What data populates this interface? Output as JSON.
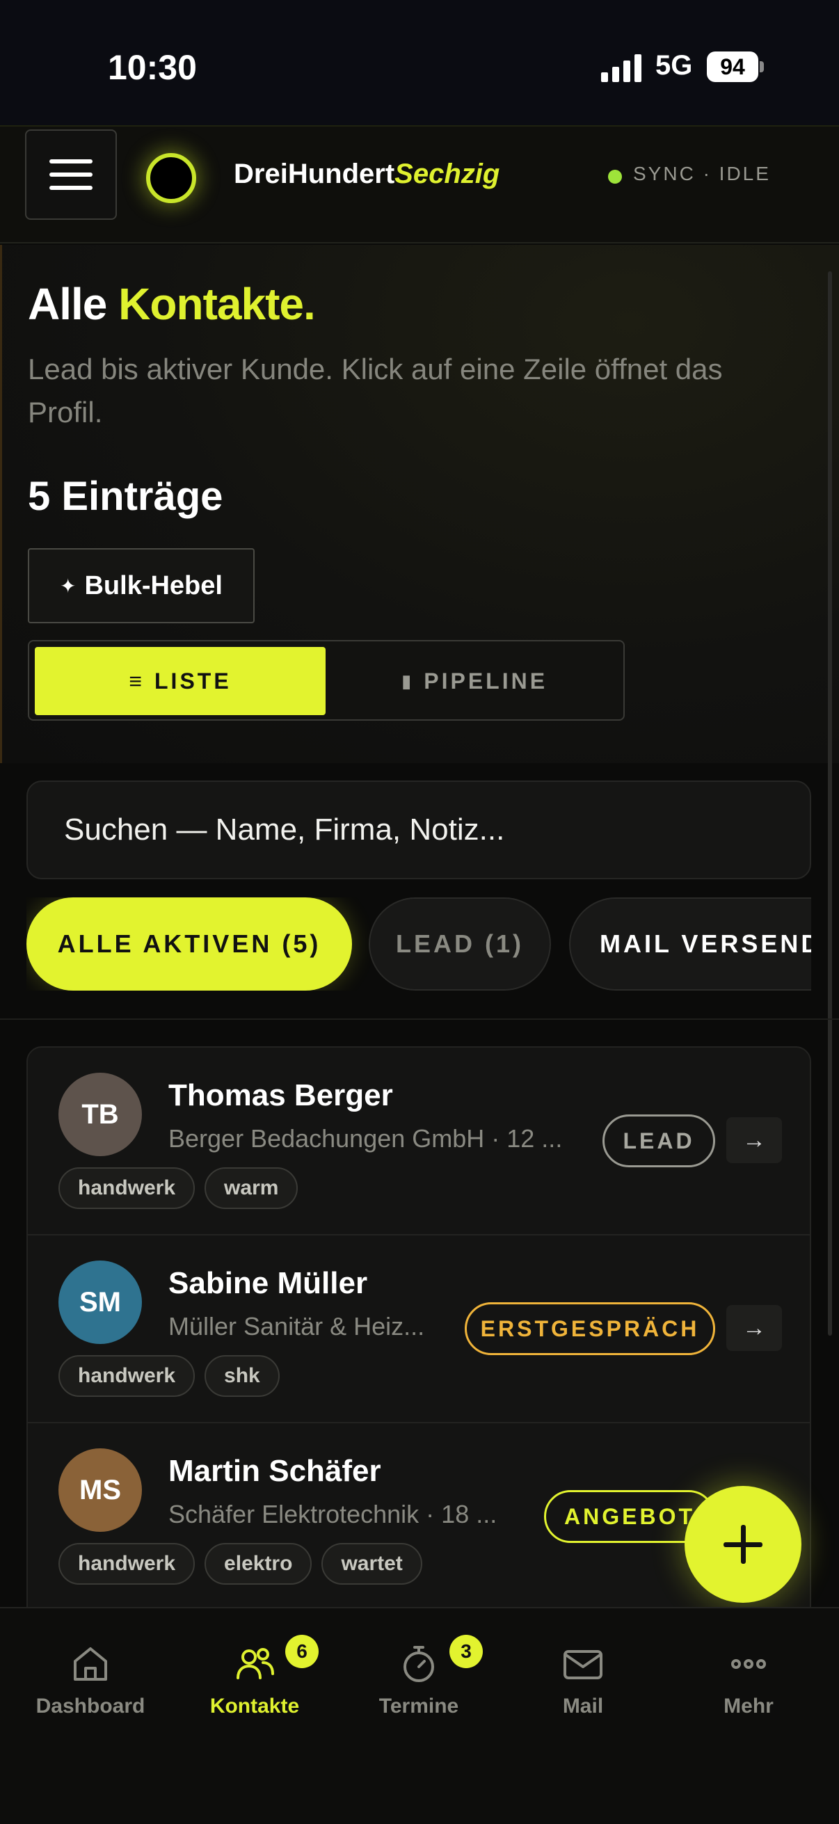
{
  "status_bar": {
    "time": "10:30",
    "network": "5G",
    "battery": "94"
  },
  "header": {
    "brand_part1": "DreiHundert",
    "brand_part2": "Sechzig",
    "sync_status": "SYNC · IDLE",
    "colors": {
      "accent": "#e2f32f",
      "sync_dot": "#9ee33a"
    }
  },
  "hero": {
    "title_part1": "Alle",
    "title_part2": "Kontakte.",
    "subtitle": "Lead bis aktiver Kunde. Klick auf eine Zeile öffnet das Profil.",
    "count_label": "5 Einträge",
    "bulk_button": "Bulk-Hebel",
    "view_toggle": {
      "list": "LISTE",
      "pipeline": "PIPELINE",
      "selected": "LISTE"
    }
  },
  "search": {
    "placeholder": "Suchen — Name, Firma, Notiz..."
  },
  "filters": [
    {
      "label": "ALLE AKTIVEN (5)",
      "active": true
    },
    {
      "label": "LEAD (1)",
      "active": false
    },
    {
      "label": "MAIL VERSEND",
      "active": false
    }
  ],
  "contacts": [
    {
      "initials": "TB",
      "name": "Thomas Berger",
      "company": "Berger Bedachungen GmbH · 12 ...",
      "status": "LEAD",
      "tags": [
        "handwerk",
        "warm"
      ],
      "avatar_color": "#5e534c",
      "status_color": "#9a9a92"
    },
    {
      "initials": "SM",
      "name": "Sabine Müller",
      "company": "Müller Sanitär & Heiz...",
      "status": "ERSTGESPRÄCH",
      "tags": [
        "handwerk",
        "shk"
      ],
      "avatar_color": "#2f7390",
      "status_color": "#f0b43a"
    },
    {
      "initials": "MS",
      "name": "Martin Schäfer",
      "company": "Schäfer Elektrotechnik · 18 ...",
      "status": "ANGEBOT",
      "tags": [
        "handwerk",
        "elektro",
        "wartet"
      ],
      "avatar_color": "#8a6238",
      "status_color": "#e2f32f"
    }
  ],
  "bottom_nav": [
    {
      "label": "Dashboard",
      "icon": "home-icon",
      "active": false,
      "badge": ""
    },
    {
      "label": "Kontakte",
      "icon": "users-icon",
      "active": true,
      "badge": "6"
    },
    {
      "label": "Termine",
      "icon": "timer-icon",
      "active": false,
      "badge": "3"
    },
    {
      "label": "Mail",
      "icon": "mail-icon",
      "active": false,
      "badge": ""
    },
    {
      "label": "Mehr",
      "icon": "more-icon",
      "active": false,
      "badge": ""
    }
  ]
}
